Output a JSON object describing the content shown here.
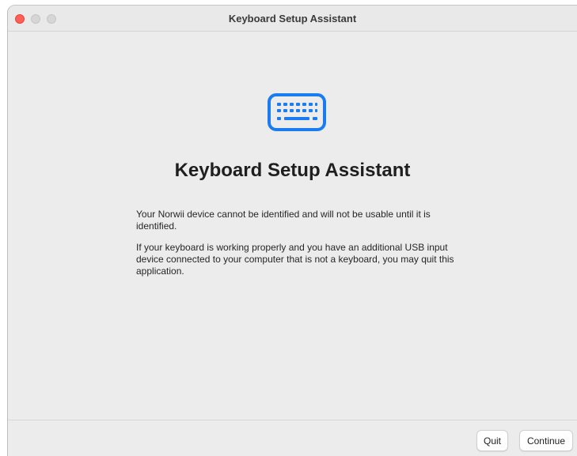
{
  "window": {
    "title": "Keyboard Setup Assistant"
  },
  "icon": {
    "name": "keyboard-icon",
    "color": "#1a7cf0"
  },
  "main": {
    "heading": "Keyboard Setup Assistant",
    "paragraphs": [
      "Your Norwii device cannot be identified and will not be usable until it is identified.",
      "If your keyboard is working properly and you have an additional USB input device connected to your computer that is not a keyboard, you may quit this application."
    ]
  },
  "footer": {
    "quit_label": "Quit",
    "continue_label": "Continue"
  }
}
